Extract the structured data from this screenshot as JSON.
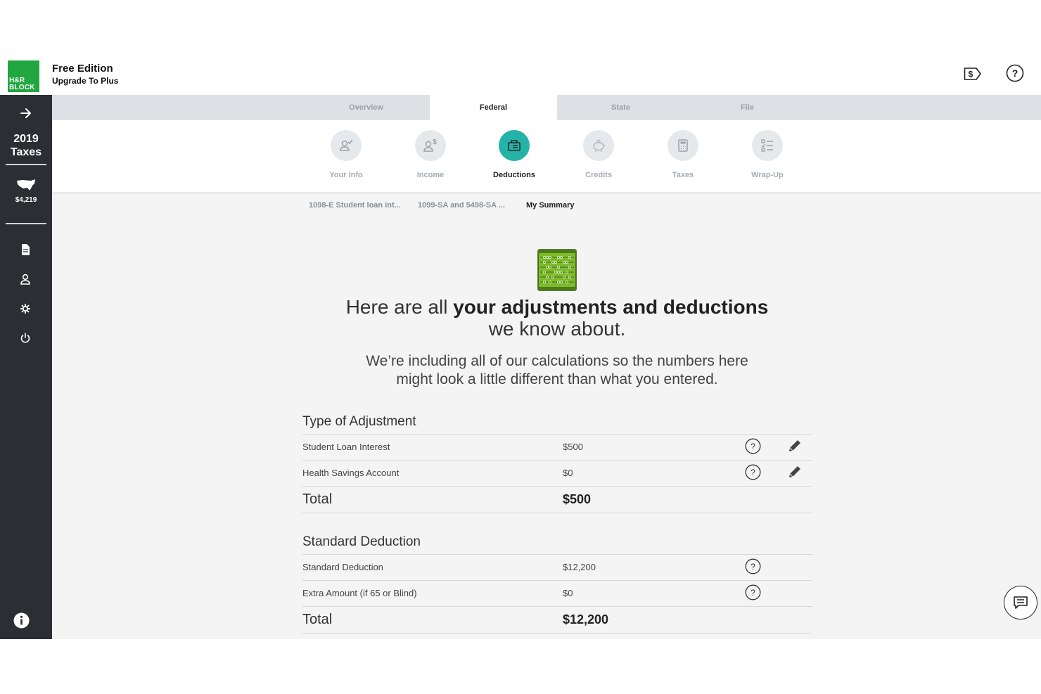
{
  "header": {
    "logo_text": "H&R BLOCK",
    "logo_line1": "H&R",
    "logo_line2": "BLOCK",
    "edition": "Free Edition",
    "upgrade": "Upgrade To Plus",
    "refund_icon": "dollar-tag-icon",
    "help_icon": "question-circle-icon"
  },
  "sidebar": {
    "year_line1": "2019",
    "year_line2": "Taxes",
    "refund_amount": "$4,219",
    "icons": [
      "document-icon",
      "person-icon",
      "gear-icon",
      "power-icon"
    ],
    "info_icon": "info-icon"
  },
  "tabs": [
    {
      "label": "Overview",
      "active": false
    },
    {
      "label": "Federal",
      "active": true
    },
    {
      "label": "State",
      "active": false
    },
    {
      "label": "File",
      "active": false
    }
  ],
  "steps": [
    {
      "label": "Your Info",
      "icon": "person-check-icon"
    },
    {
      "label": "Income",
      "icon": "person-dollar-icon"
    },
    {
      "label": "Deductions",
      "icon": "deductions-icon",
      "active": true
    },
    {
      "label": "Credits",
      "icon": "piggy-bank-icon"
    },
    {
      "label": "Taxes",
      "icon": "calculator-icon"
    },
    {
      "label": "Wrap-Up",
      "icon": "checklist-icon"
    }
  ],
  "breadcrumbs": [
    "1098-E Student loan int...",
    "1099-SA and 5498-SA ...",
    "My Summary"
  ],
  "headline": {
    "prefix": "Here are all ",
    "bold": "your adjustments and deductions",
    "suffix": "we know about."
  },
  "subtext": {
    "line1": "We’re including all of our calculations so the numbers here",
    "line2": "might look a little different than what you entered."
  },
  "adjustments": {
    "title": "Type of Adjustment",
    "rows": [
      {
        "label": "Student Loan Interest",
        "amount": "$500"
      },
      {
        "label": "Health Savings Account",
        "amount": "$0"
      }
    ],
    "total_label": "Total",
    "total_amount": "$500"
  },
  "standard": {
    "title": "Standard Deduction",
    "rows": [
      {
        "label": "Standard Deduction",
        "amount": "$12,200"
      },
      {
        "label": "Extra Amount (if 65 or Blind)",
        "amount": "$0"
      }
    ],
    "total_label": "Total",
    "total_amount": "$12,200"
  },
  "colors": {
    "brand_green": "#22a640",
    "accent_teal": "#25b3a8",
    "sidebar_bg": "#2b2e33"
  }
}
